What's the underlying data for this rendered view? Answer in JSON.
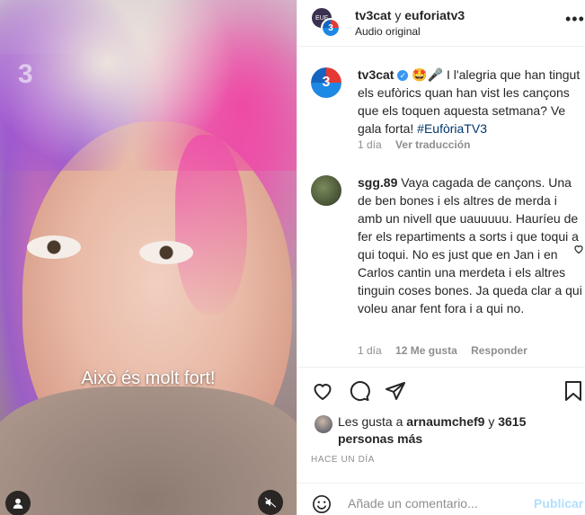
{
  "media": {
    "logo_text": "3",
    "caption": "Això és molt fort!",
    "icons": {
      "user": "user-icon",
      "mute": "speaker-muted-icon"
    }
  },
  "header": {
    "owner": "tv3cat",
    "joiner": " y ",
    "collaborator": "euforiatv3",
    "audio": "Audio original",
    "more_icon": "more-horizontal-icon"
  },
  "comments": [
    {
      "user": "tv3cat",
      "verified": true,
      "text": "🤩🎤 I l'alegria que han tingut els eufòrics quan han vist les cançons que els toquen aquesta setmana? Ve gala forta! ",
      "hashtag": "#EufòriaTV3",
      "time": "1 día",
      "translate": "Ver traducción"
    },
    {
      "user": "sgg.89",
      "text": "Vaya cagada de cançons. Una de ben bones i els altres de merda i amb un nivell que uauuuuu. Hauríeu de fer els repartiments a sorts i que toqui a qui toqui. No es just que en Jan i en Carlos cantin una merdeta i els altres tinguin coses bones. Ja queda clar a qui voleu anar fent fora i a qui no.",
      "time": "1 día",
      "likes": "12 Me gusta",
      "reply": "Responder"
    }
  ],
  "actions": {
    "like_icon": "heart-icon",
    "comment_icon": "comment-icon",
    "share_icon": "paper-plane-icon",
    "save_icon": "bookmark-icon"
  },
  "likes": {
    "prefix": "Les gusta a ",
    "user": "arnaumchef9",
    "middle": " y ",
    "count": "3615",
    "suffix": " personas más"
  },
  "time_ago": "HACE UN DÍA",
  "composer": {
    "placeholder": "Añade un comentario...",
    "publish": "Publicar"
  },
  "colors": {
    "link": "#00376b",
    "muted": "#8e8e8e",
    "publish_disabled": "#b2dffc",
    "verified": "#3897f0"
  }
}
